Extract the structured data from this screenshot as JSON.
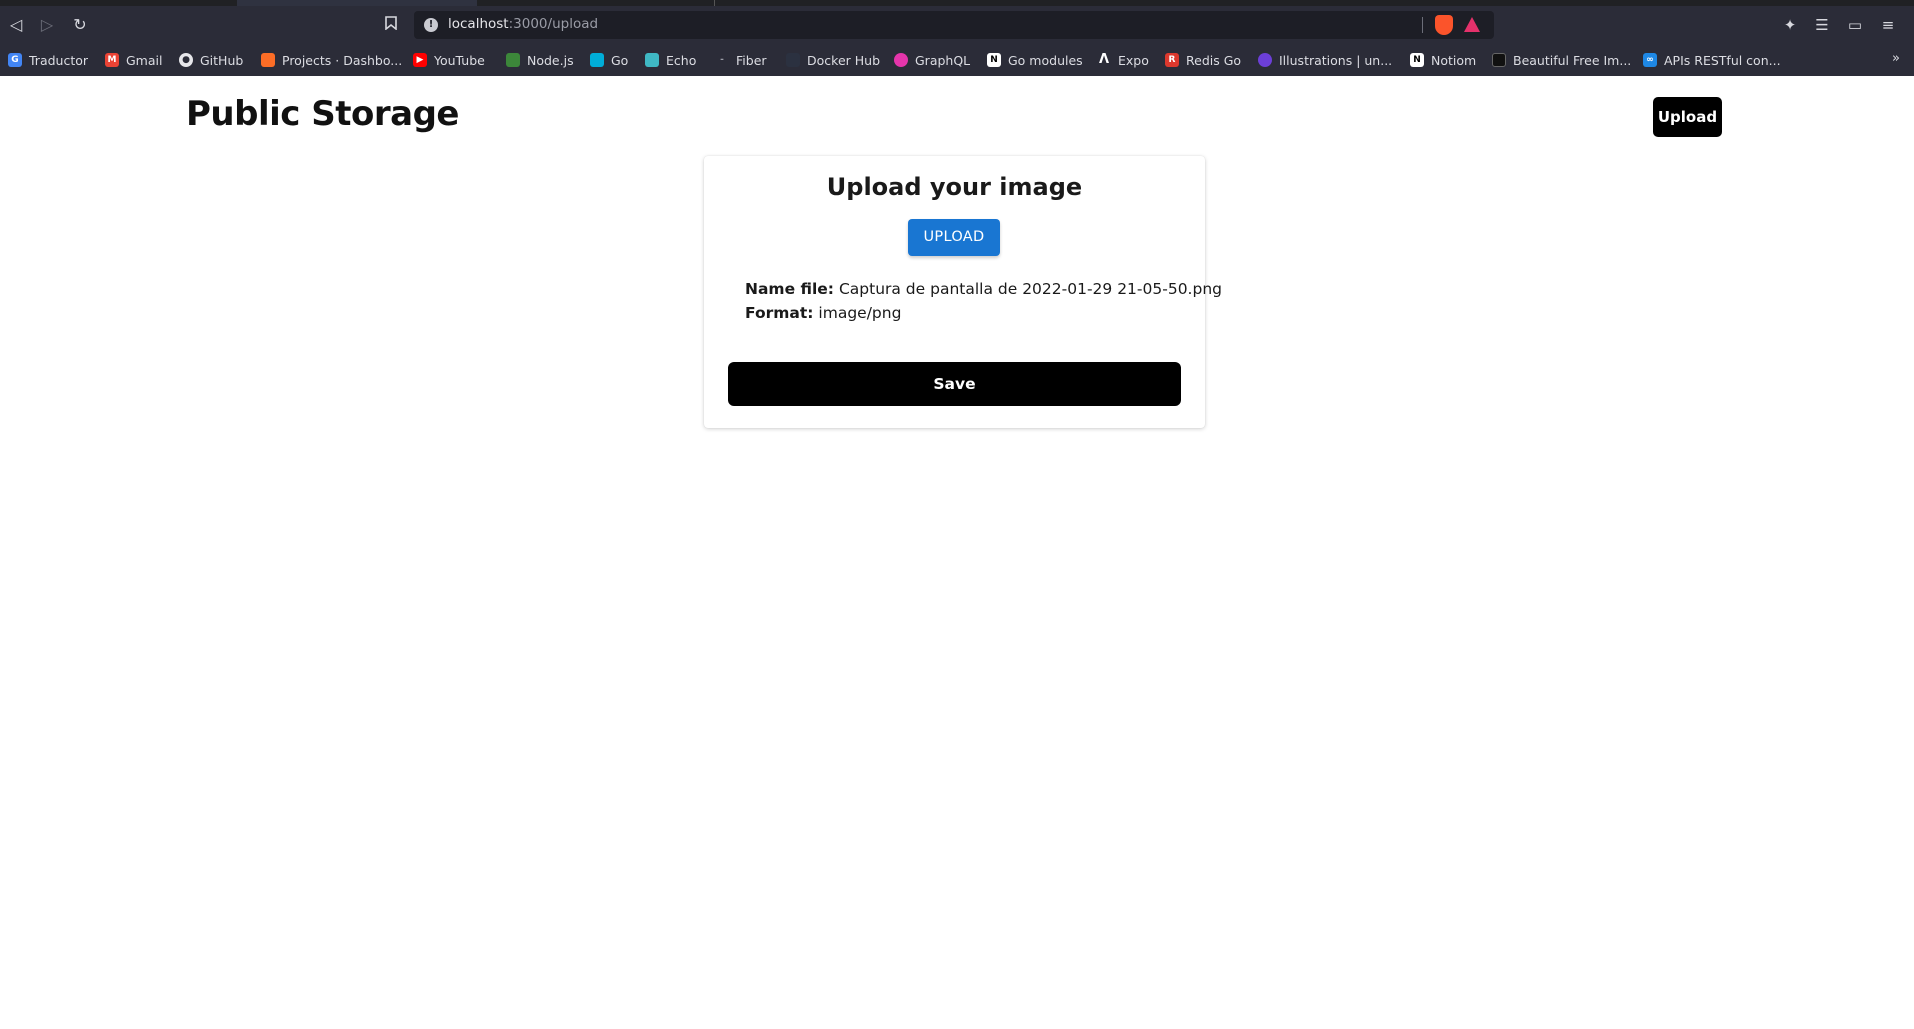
{
  "browser": {
    "url_host": "localhost",
    "url_path": ":3000/upload",
    "bookmarks": [
      {
        "label": "Traductor",
        "icon": "google-translate-icon",
        "color": "#4285f4"
      },
      {
        "label": "Gmail",
        "icon": "gmail-icon",
        "color": "#ea4335"
      },
      {
        "label": "GitHub",
        "icon": "github-icon",
        "color": "#e6e6ea"
      },
      {
        "label": "Projects · Dashbo...",
        "icon": "gitlab-icon",
        "color": "#fc6d26"
      },
      {
        "label": "YouTube",
        "icon": "youtube-icon",
        "color": "#ff0000"
      },
      {
        "label": "Node.js",
        "icon": "nodejs-icon",
        "color": "#3c873a"
      },
      {
        "label": "Go",
        "icon": "go-icon",
        "color": "#00add8"
      },
      {
        "label": "Echo",
        "icon": "echo-icon",
        "color": "#3fb8c4"
      },
      {
        "label": "Fiber",
        "icon": "fiber-icon",
        "color": "#2b2c38"
      },
      {
        "label": "Docker Hub",
        "icon": "docker-icon",
        "color": "#2b3140"
      },
      {
        "label": "GraphQL",
        "icon": "graphql-icon",
        "color": "#e535ab"
      },
      {
        "label": "Go modules",
        "icon": "notion-icon",
        "color": "#ffffff"
      },
      {
        "label": "Expo",
        "icon": "expo-icon",
        "color": "#ffffff"
      },
      {
        "label": "Redis Go",
        "icon": "redis-icon",
        "color": "#dc382d"
      },
      {
        "label": "Illustrations | un...",
        "icon": "illustrations-icon",
        "color": "#6c3fd8"
      },
      {
        "label": "Notiom",
        "icon": "notion-icon",
        "color": "#ffffff"
      },
      {
        "label": "Beautiful Free Im...",
        "icon": "unsplash-icon",
        "color": "#111111"
      },
      {
        "label": "APIs RESTful con...",
        "icon": "apis-icon",
        "color": "#1e88e5"
      }
    ],
    "more": "»"
  },
  "header": {
    "title": "Public Storage",
    "upload_label": "Upload"
  },
  "card": {
    "title": "Upload your image",
    "upload_label": "UPLOAD",
    "name_label": "Name file:",
    "name_value": "Captura de pantalla de 2022-01-29 21-05-50.png",
    "format_label": "Format:",
    "format_value": "image/png",
    "save_label": "Save"
  },
  "colors": {
    "accent": "#1976d2",
    "primary": "#000000"
  }
}
